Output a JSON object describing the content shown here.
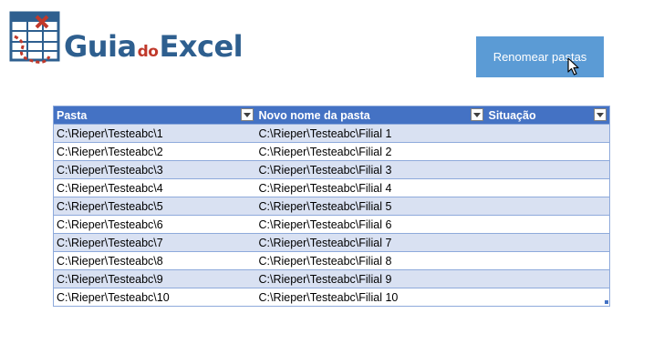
{
  "logo": {
    "part1": "Guia",
    "part2": "do",
    "part3": "Excel"
  },
  "button": {
    "label": "Renomear pastas"
  },
  "table": {
    "columns": [
      "Pasta",
      "Novo nome da pasta",
      "Situação"
    ],
    "rows": [
      [
        "C:\\Rieper\\Testeabc\\1",
        "C:\\Rieper\\Testeabc\\Filial 1",
        ""
      ],
      [
        "C:\\Rieper\\Testeabc\\2",
        "C:\\Rieper\\Testeabc\\Filial 2",
        ""
      ],
      [
        "C:\\Rieper\\Testeabc\\3",
        "C:\\Rieper\\Testeabc\\Filial 3",
        ""
      ],
      [
        "C:\\Rieper\\Testeabc\\4",
        "C:\\Rieper\\Testeabc\\Filial 4",
        ""
      ],
      [
        "C:\\Rieper\\Testeabc\\5",
        "C:\\Rieper\\Testeabc\\Filial 5",
        ""
      ],
      [
        "C:\\Rieper\\Testeabc\\6",
        "C:\\Rieper\\Testeabc\\Filial 6",
        ""
      ],
      [
        "C:\\Rieper\\Testeabc\\7",
        "C:\\Rieper\\Testeabc\\Filial 7",
        ""
      ],
      [
        "C:\\Rieper\\Testeabc\\8",
        "C:\\Rieper\\Testeabc\\Filial 8",
        ""
      ],
      [
        "C:\\Rieper\\Testeabc\\9",
        "C:\\Rieper\\Testeabc\\Filial 9",
        ""
      ],
      [
        "C:\\Rieper\\Testeabc\\10",
        "C:\\Rieper\\Testeabc\\Filial 10",
        ""
      ]
    ]
  },
  "icons": {
    "filter": "filter-dropdown-icon",
    "cursor": "mouse-pointer-icon",
    "logo": "spreadsheet-logo-icon"
  },
  "colors": {
    "header_bg": "#4472c4",
    "band_row": "#d9e1f2",
    "button_bg": "#5b9bd5",
    "logo_blue": "#2e5f8f",
    "logo_red": "#c0392b"
  }
}
